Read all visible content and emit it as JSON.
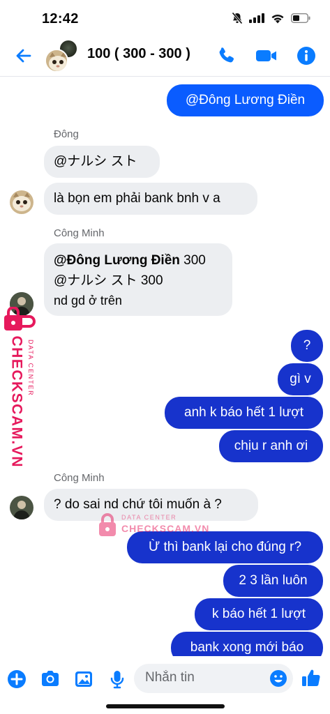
{
  "status_bar": {
    "time": "12:42"
  },
  "header": {
    "title": "100 ( 300 - 300 )"
  },
  "messages": [
    {
      "text": "@Đông Lương Điền"
    },
    {
      "sender": "Đông"
    },
    {
      "text": "@ナルシ スト"
    },
    {
      "text": "là bọn em phải bank bnh v a"
    },
    {
      "sender": "Công Minh"
    },
    {
      "mention1": "@Đông Lương Điền",
      "amount1": " 300",
      "line2": "@ナルシ スト 300",
      "line3": "nd gd ở trên"
    },
    {
      "text": "?"
    },
    {
      "text": "gì v"
    },
    {
      "text": "anh k báo hết 1 lượt"
    },
    {
      "text": "chịu r anh ơi"
    },
    {
      "sender": "Công Minh"
    },
    {
      "text": "? do sai nd chứ tôi muốn à ?"
    },
    {
      "text": "Ừ thì bank lại cho đúng r?"
    },
    {
      "text": "2 3 lần luôn"
    },
    {
      "text": "k báo hết 1 lượt"
    },
    {
      "text": "bank xong mới báo"
    }
  ],
  "watermark": {
    "brand": "CHECKSCAM.VN",
    "tagline": "DATA CENTER"
  },
  "composer": {
    "placeholder": "Nhắn tin"
  },
  "colors": {
    "accent": "#0a5cff",
    "sent_dark": "#1733cc",
    "received": "#eceef1",
    "watermark": "#e6195c"
  }
}
